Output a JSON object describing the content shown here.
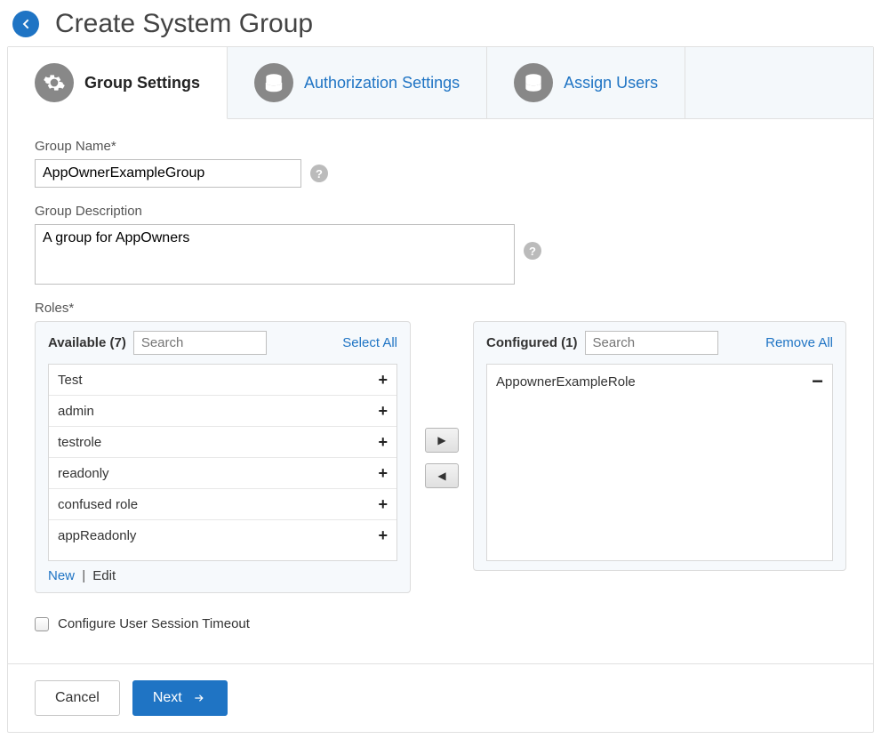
{
  "header": {
    "title": "Create System Group"
  },
  "tabs": [
    {
      "label": "Group Settings",
      "icon": "gear-icon",
      "active": true
    },
    {
      "label": "Authorization Settings",
      "icon": "database-icon",
      "active": false
    },
    {
      "label": "Assign Users",
      "icon": "database-icon",
      "active": false
    }
  ],
  "form": {
    "group_name_label": "Group Name*",
    "group_name_value": "AppOwnerExampleGroup",
    "group_desc_label": "Group Description",
    "group_desc_value": "A group for AppOwners",
    "roles_label": "Roles*",
    "timeout_checkbox_label": "Configure User Session Timeout",
    "timeout_checked": false
  },
  "roles": {
    "available": {
      "title": "Available",
      "count": 7,
      "search_placeholder": "Search",
      "select_all_label": "Select All",
      "items": [
        "Test",
        "admin",
        "testrole",
        "readonly",
        "confused role",
        "appReadonly"
      ],
      "footer_new": "New",
      "footer_edit": "Edit"
    },
    "configured": {
      "title": "Configured",
      "count": 1,
      "search_placeholder": "Search",
      "remove_all_label": "Remove All",
      "items": [
        "AppownerExampleRole"
      ]
    }
  },
  "footer": {
    "cancel_label": "Cancel",
    "next_label": "Next"
  }
}
